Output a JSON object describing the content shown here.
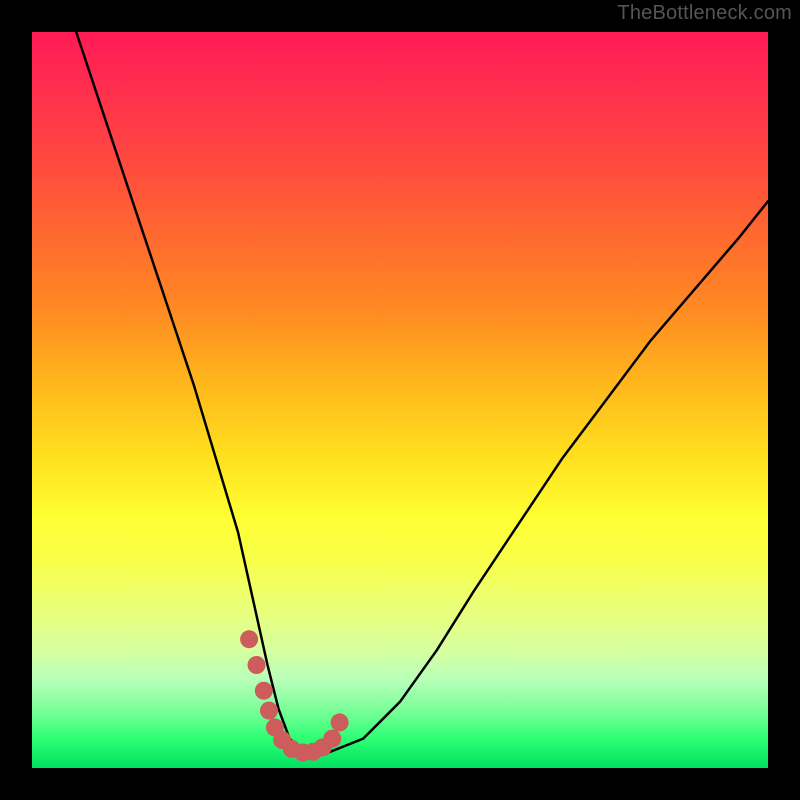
{
  "watermark": "TheBottleneck.com",
  "chart_data": {
    "type": "line",
    "title": "",
    "xlabel": "",
    "ylabel": "",
    "xlim": [
      0,
      100
    ],
    "ylim": [
      0,
      100
    ],
    "grid": false,
    "legend": "none",
    "series": [
      {
        "name": "bottleneck-curve",
        "x": [
          6,
          10,
          14,
          18,
          22,
          25,
          28,
          30,
          32,
          33.5,
          35,
          37,
          40,
          45,
          50,
          55,
          60,
          66,
          72,
          78,
          84,
          90,
          96,
          100
        ],
        "values": [
          100,
          88,
          76,
          64,
          52,
          42,
          32,
          23,
          14,
          8,
          4,
          2,
          2,
          4,
          9,
          16,
          24,
          33,
          42,
          50,
          58,
          65,
          72,
          77
        ]
      }
    ],
    "markers": {
      "name": "highlight-points",
      "x": [
        29.5,
        30.5,
        31.5,
        32.2,
        33.0,
        34.0,
        35.3,
        36.8,
        38.2,
        39.5,
        40.8,
        41.8
      ],
      "values": [
        17.5,
        14.0,
        10.5,
        7.8,
        5.5,
        3.8,
        2.6,
        2.1,
        2.2,
        2.8,
        4.0,
        6.2
      ],
      "radius_px": 9
    },
    "background": {
      "type": "vertical-gradient",
      "stops": [
        {
          "pos": 0.0,
          "color": "#ff1a56"
        },
        {
          "pos": 0.18,
          "color": "#ff4a3f"
        },
        {
          "pos": 0.38,
          "color": "#ff8b22"
        },
        {
          "pos": 0.58,
          "color": "#ffe11e"
        },
        {
          "pos": 0.72,
          "color": "#f8ff4a"
        },
        {
          "pos": 0.88,
          "color": "#b8ffb8"
        },
        {
          "pos": 1.0,
          "color": "#00e060"
        }
      ]
    }
  }
}
